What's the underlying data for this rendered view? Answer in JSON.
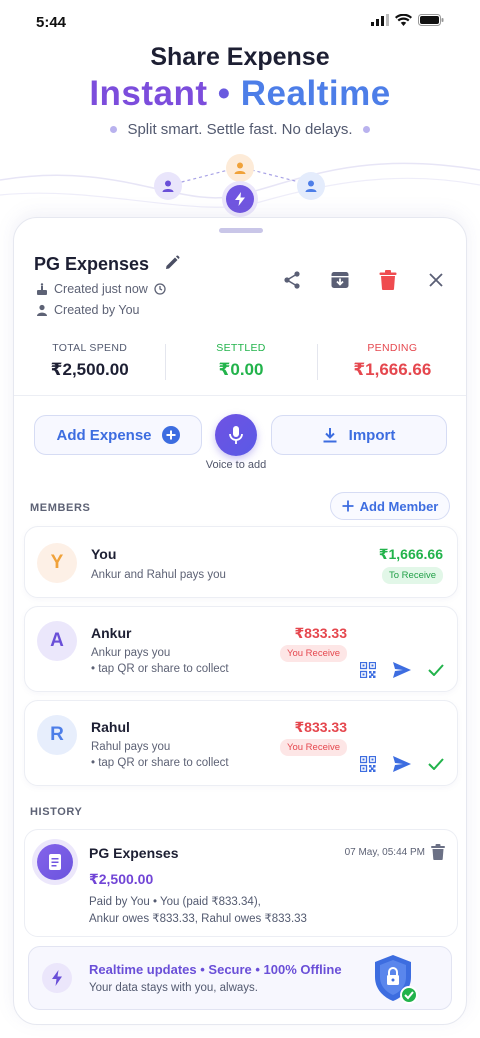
{
  "status_bar": {
    "time": "5:44"
  },
  "hero": {
    "title": "Share Expense",
    "headline_a": "Instant",
    "headline_dot": "•",
    "headline_b": "Realtime",
    "tagline": "Split smart. Settle fast. No delays."
  },
  "group": {
    "name": "PG Expenses",
    "created": "Created just now",
    "created_by": "Created by You"
  },
  "stats": [
    {
      "label": "TOTAL SPEND",
      "value": "₹2,500.00",
      "color": "#1d1f33"
    },
    {
      "label": "SETTLED",
      "value": "₹0.00",
      "color": "#22b34b"
    },
    {
      "label": "PENDING",
      "value": "₹1,666.66",
      "color": "#e5474e"
    }
  ],
  "actions": {
    "add_expense": "Add Expense",
    "voice_label": "Voice to add",
    "import": "Import"
  },
  "members_section": {
    "label": "MEMBERS",
    "add_member": "Add Member",
    "members": [
      {
        "initial": "Y",
        "name": "You",
        "line1": "Ankur and Rahul pays you",
        "line2": "",
        "amount": "₹1,666.66",
        "badge": "To Receive"
      },
      {
        "initial": "A",
        "name": "Ankur",
        "line1": "Ankur pays you",
        "line2": "• tap QR or share to collect",
        "amount": "₹833.33",
        "badge": "You Receive"
      },
      {
        "initial": "R",
        "name": "Rahul",
        "line1": "Rahul pays you",
        "line2": "• tap QR or share to collect",
        "amount": "₹833.33",
        "badge": "You Receive"
      }
    ]
  },
  "history_section": {
    "label": "HISTORY",
    "items": [
      {
        "title": "PG Expenses",
        "date": "07 May, 05:44 PM",
        "amount": "₹2,500.00",
        "desc_line1": "Paid by You • You (paid ₹833.34),",
        "desc_line2": "Ankur owes ₹833.33, Rahul owes ₹833.33"
      }
    ]
  },
  "banner": {
    "title": "Realtime updates  •  Secure  •  100% Offline",
    "subtitle": "Your data stays with you, always."
  },
  "colors": {
    "accent": "#3d6de0",
    "purple": "#7145d6",
    "green": "#22b34b",
    "red": "#e5474e"
  }
}
